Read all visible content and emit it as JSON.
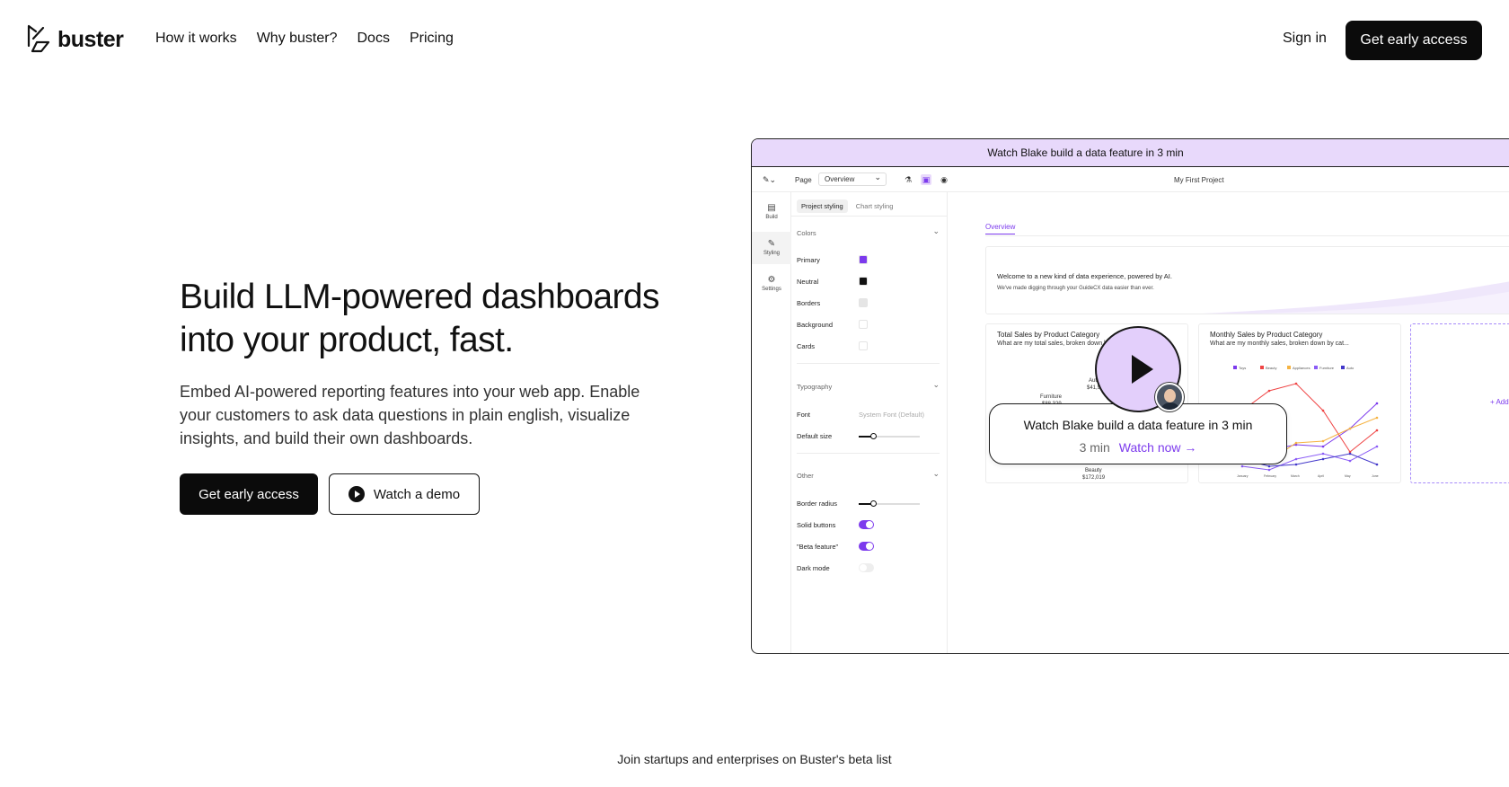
{
  "brand": {
    "name": "buster"
  },
  "nav": {
    "links": [
      "How it works",
      "Why buster?",
      "Docs",
      "Pricing"
    ],
    "sign_in": "Sign in",
    "cta": "Get early access"
  },
  "hero": {
    "title": "Build LLM-powered dashboards into your product, fast.",
    "description": "Embed AI-powered reporting features into your web app. Enable your customers to ask data questions in plain english, visualize insights, and build their own dashboards.",
    "primary_button": "Get early access",
    "secondary_button": "Watch a demo"
  },
  "beta_line": "Join startups and enterprises on Buster's beta list",
  "mockup": {
    "banner": "Watch Blake build a data feature in 3 min",
    "toolbar": {
      "page_label": "Page",
      "page_value": "Overview",
      "project": "My First Project"
    },
    "rail": [
      {
        "label": "Build",
        "icon": "chart-icon"
      },
      {
        "label": "Styling",
        "icon": "brush-icon"
      },
      {
        "label": "Settings",
        "icon": "gear-icon"
      }
    ],
    "panel": {
      "tabs": [
        "Project styling",
        "Chart styling"
      ],
      "colors_heading": "Colors",
      "colors": [
        {
          "label": "Primary",
          "hex": "#7c3aed"
        },
        {
          "label": "Neutral",
          "hex": "#111111"
        },
        {
          "label": "Borders",
          "hex": "#e5e5e5"
        },
        {
          "label": "Background",
          "hex": "#ffffff"
        },
        {
          "label": "Cards",
          "hex": "#ffffff"
        }
      ],
      "typography_heading": "Typography",
      "font_label": "Font",
      "font_value": "System Font (Default)",
      "default_size_label": "Default size",
      "default_size_level": 0.24,
      "other_heading": "Other",
      "border_radius_label": "Border radius",
      "border_radius_level": 0.24,
      "toggles": [
        {
          "label": "Solid buttons",
          "on": true
        },
        {
          "label": "\"Beta feature\"",
          "on": true
        },
        {
          "label": "Dark mode",
          "on": false
        }
      ]
    },
    "main": {
      "tab": "Overview",
      "welcome_title": "Welcome to a new kind of data experience, powered by AI.",
      "welcome_sub": "We've made digging through your GuideCX data easier than ever.",
      "card1_title": "Total Sales by Product Category",
      "card1_sub": "What are my total sales, broken down by category?",
      "card1_labels": [
        "Auto",
        "$41,952",
        "Furniture",
        "$88,329",
        "Beauty",
        "$172,019"
      ],
      "card2_title": "Monthly Sales by Product Category",
      "card2_sub": "What are my monthly sales, broken down by cat...",
      "card2_legend": [
        "Toys",
        "Beauty",
        "Appliances",
        "Furniture",
        "Auto"
      ],
      "card2_months": [
        "January",
        "February",
        "March",
        "April",
        "May",
        "June"
      ],
      "add_text": "+ Add"
    },
    "overlay": {
      "title": "Watch Blake build a data feature in 3 min",
      "duration": "3 min",
      "link": "Watch now"
    }
  },
  "colors": {
    "accent": "#7c3aed",
    "accent_light": "#e8d9fb",
    "dark": "#0b0b0b"
  }
}
